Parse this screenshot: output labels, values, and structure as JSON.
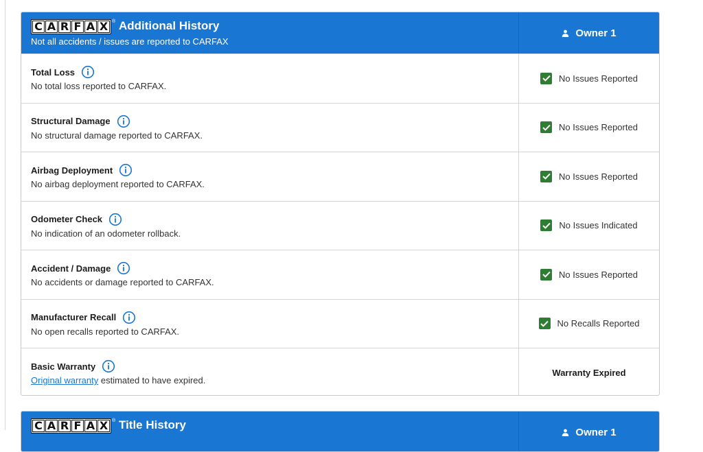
{
  "brand": {
    "letters": [
      "C",
      "A",
      "R",
      "F",
      "A",
      "X"
    ],
    "reg_mark": "®"
  },
  "colors": {
    "header_bg": "#1976d2",
    "check_green": "#2e7d32",
    "link_blue": "#1976d2"
  },
  "additional_history": {
    "title": "Additional History",
    "subtitle": "Not all accidents / issues are reported to CARFAX",
    "owner_label": "Owner 1",
    "rows": [
      {
        "title": "Total Loss",
        "description": "No total loss reported to CARFAX.",
        "status": "No Issues Reported",
        "icon": "check-icon"
      },
      {
        "title": "Structural Damage",
        "description": "No structural damage reported to CARFAX.",
        "status": "No Issues Reported",
        "icon": "check-icon"
      },
      {
        "title": "Airbag Deployment",
        "description": "No airbag deployment reported to CARFAX.",
        "status": "No Issues Reported",
        "icon": "check-icon"
      },
      {
        "title": "Odometer Check",
        "description": "No indication of an odometer rollback.",
        "status": "No Issues Indicated",
        "icon": "check-icon"
      },
      {
        "title": "Accident / Damage",
        "description": "No accidents or damage reported to CARFAX.",
        "status": "No Issues Reported",
        "icon": "check-icon"
      },
      {
        "title": "Manufacturer Recall",
        "description": "No open recalls reported to CARFAX.",
        "status": "No Recalls Reported",
        "icon": "check-icon"
      },
      {
        "title": "Basic Warranty",
        "description_link": "Original warranty",
        "description_rest": " estimated to have expired.",
        "status": "Warranty Expired"
      }
    ]
  },
  "title_history": {
    "title": "Title History",
    "owner_label": "Owner 1"
  }
}
